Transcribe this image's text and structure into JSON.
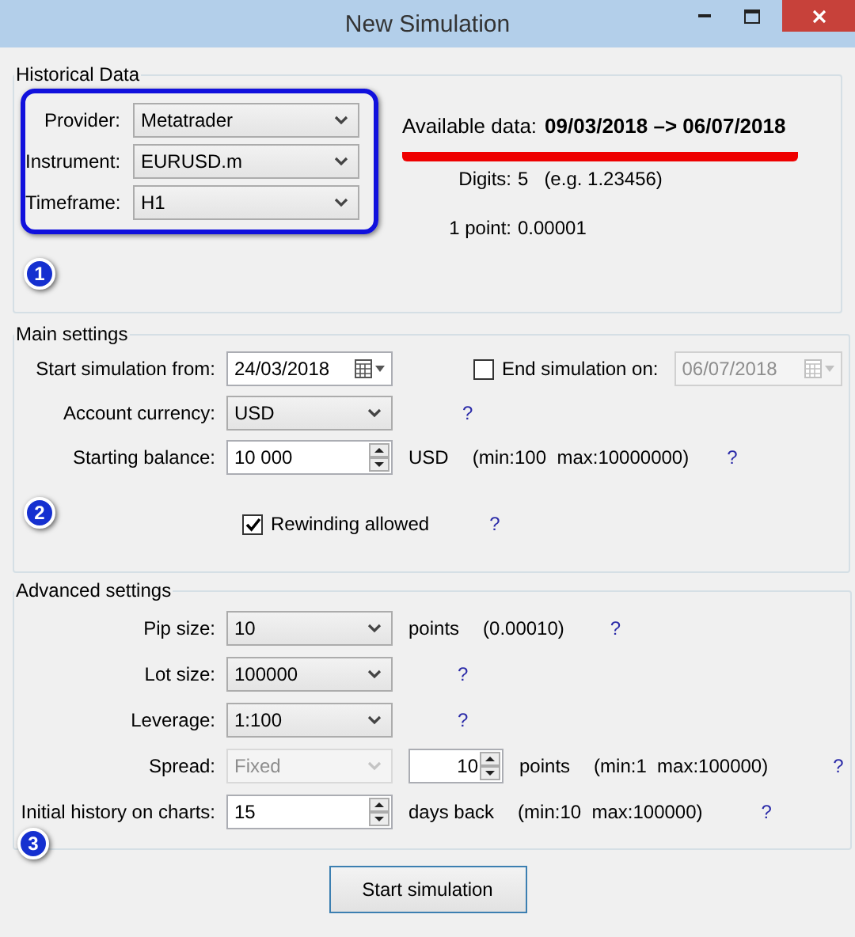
{
  "window": {
    "title": "New Simulation"
  },
  "historical_data": {
    "title": "Historical Data",
    "fields": [
      {
        "label": "Provider:",
        "value": "Metatrader"
      },
      {
        "label": "Instrument:",
        "value": "EURUSD.m"
      },
      {
        "label": "Timeframe:",
        "value": "H1"
      }
    ],
    "available_data": {
      "label": "Available data:",
      "value": "09/03/2018 –> 06/07/2018"
    },
    "digits": {
      "label": "Digits:",
      "value": "5",
      "example": "(e.g. 1.23456)"
    },
    "point": {
      "label": "1 point:",
      "value": "0.00001"
    },
    "marker": "1"
  },
  "main_settings": {
    "title": "Main settings",
    "start": {
      "label": "Start simulation from:",
      "value": "24/03/2018"
    },
    "end": {
      "label": "End simulation on:",
      "checked": false,
      "value": "06/07/2018",
      "disabled": true
    },
    "currency": {
      "label": "Account currency:",
      "value": "USD",
      "help": "?"
    },
    "balance": {
      "label": "Starting balance:",
      "value": "10 000",
      "unit": "USD",
      "range": "(min:100  max:10000000)",
      "help": "?"
    },
    "marker": "2",
    "rewinding": {
      "label": "Rewinding allowed",
      "checked": true,
      "help": "?"
    }
  },
  "advanced_settings": {
    "title": "Advanced settings",
    "rows": [
      {
        "kind": "select",
        "label": "Pip size:",
        "value": "10",
        "unit": "points",
        "note": "(0.00010)",
        "help": "?"
      },
      {
        "kind": "select",
        "label": "Lot size:",
        "value": "100000",
        "help": "?"
      },
      {
        "kind": "select",
        "label": "Leverage:",
        "value": "1:100",
        "help": "?"
      },
      {
        "kind": "select_spinner",
        "label": "Spread:",
        "value": "Fixed",
        "disabled": true,
        "amount": "10",
        "unit": "points",
        "note": "(min:1  max:100000)",
        "help": "?"
      },
      {
        "kind": "spinner",
        "label": "Initial history on charts:",
        "value": "15",
        "unit": "days back",
        "note": "(min:10  max:100000)",
        "help": "?"
      }
    ],
    "marker": "3"
  },
  "start_button": "Start simulation"
}
